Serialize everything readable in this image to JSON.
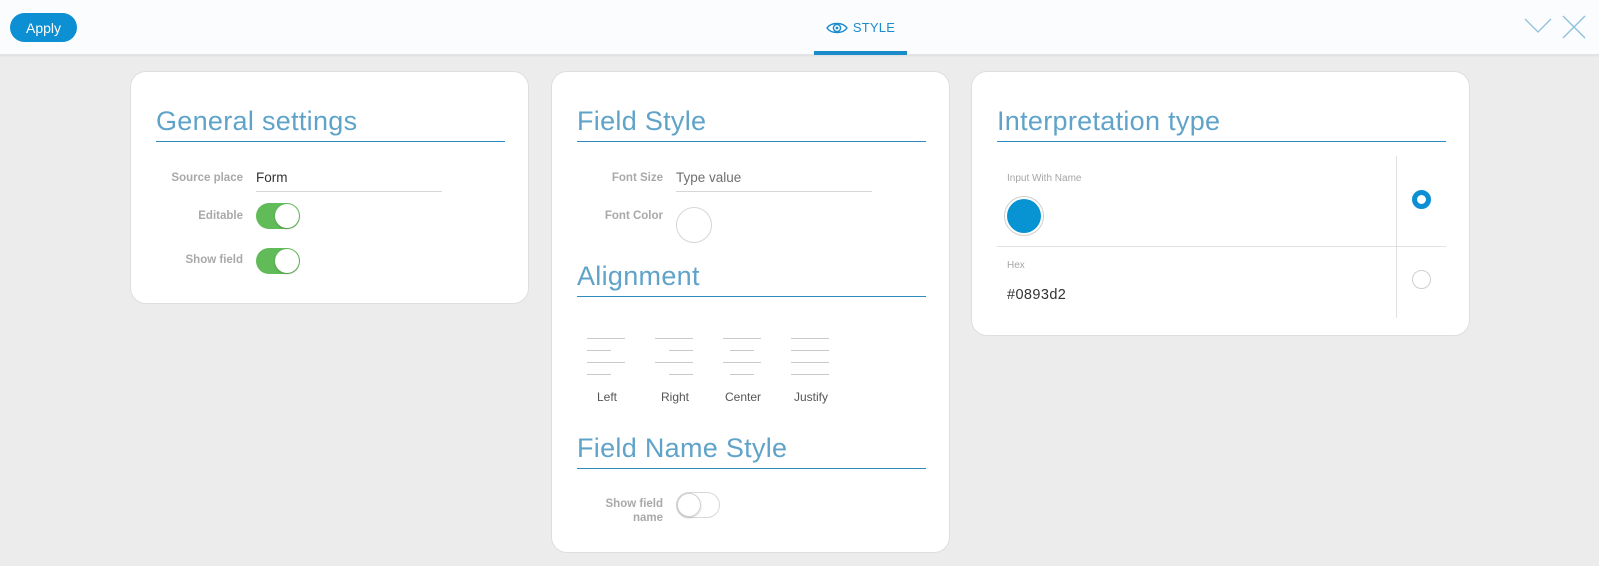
{
  "toolbar": {
    "apply_label": "Apply",
    "active_tab_label": "STYLE",
    "tab_icon": "eye-icon",
    "accent_color": "#0d8fd3"
  },
  "general_settings": {
    "title": "General settings",
    "source_place_label": "Source place",
    "source_place_value": "Form",
    "editable_label": "Editable",
    "editable_on": true,
    "show_field_label": "Show field",
    "show_field_on": true,
    "toggle_on_color": "#61bb58"
  },
  "field_style": {
    "title": "Field Style",
    "font_size_label": "Font Size",
    "font_size_placeholder": "Type value",
    "font_color_label": "Font Color"
  },
  "alignment": {
    "title": "Alignment",
    "options": [
      {
        "label": "Left"
      },
      {
        "label": "Right"
      },
      {
        "label": "Center"
      },
      {
        "label": "Justify"
      }
    ]
  },
  "field_name_style": {
    "title": "Field Name Style",
    "show_field_name_label": "Show field name",
    "show_field_name_on": false
  },
  "interpretation": {
    "title": "Interpretation type",
    "input_with_name_label": "Input With Name",
    "swatch_color": "#0893d2",
    "hex_label": "Hex",
    "hex_value": "#0893d2",
    "selected_option": "Input With Name"
  }
}
